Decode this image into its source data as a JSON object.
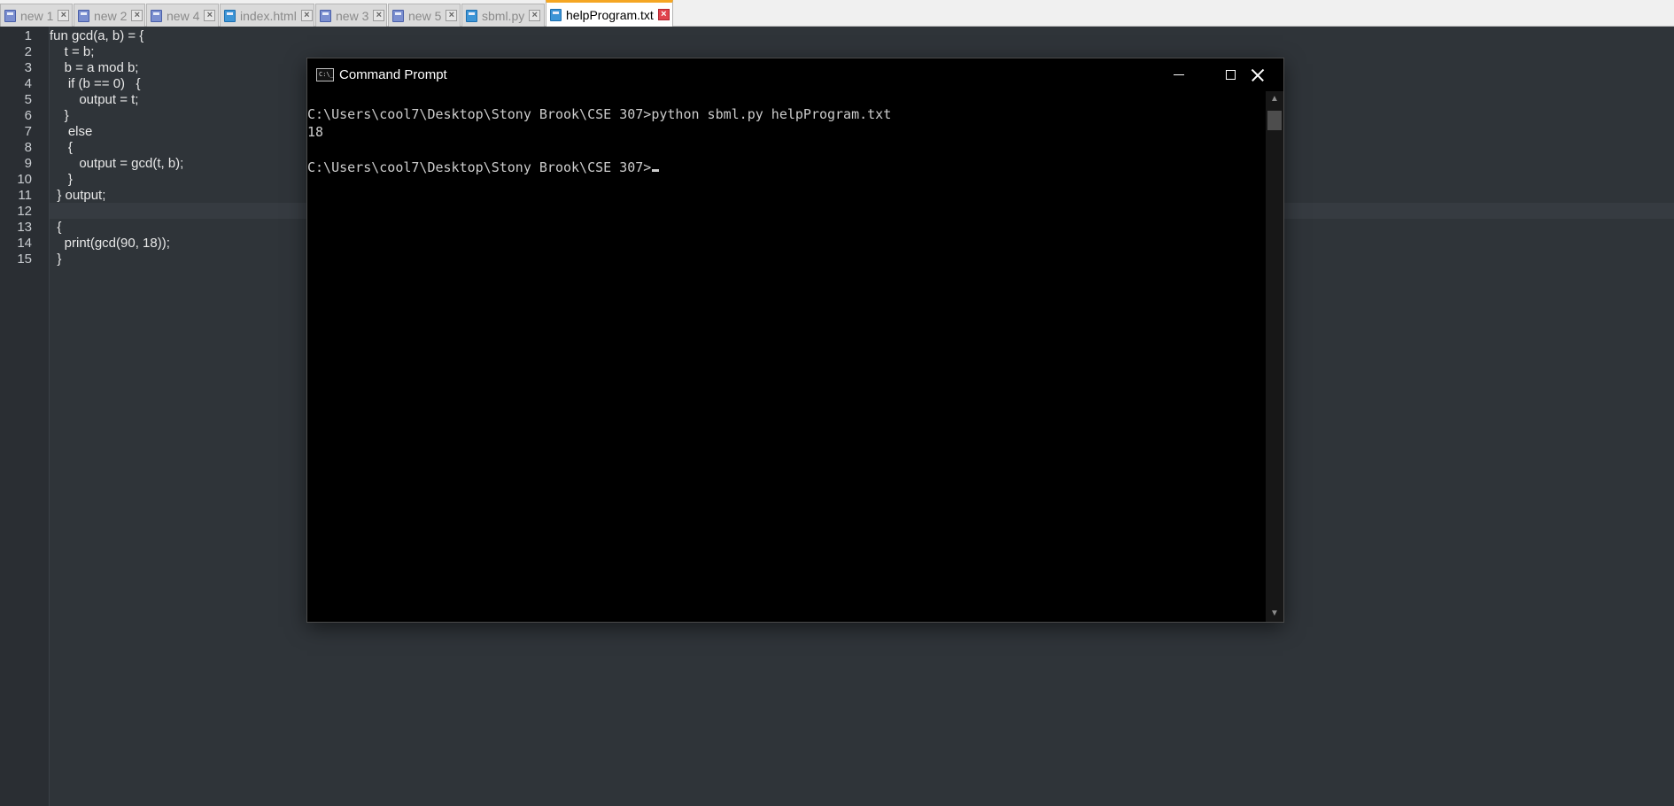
{
  "tabs": [
    {
      "label": "new 1",
      "icon": "document-icon",
      "active": false
    },
    {
      "label": "new 2",
      "icon": "document-icon",
      "active": false
    },
    {
      "label": "new 4",
      "icon": "document-icon",
      "active": false
    },
    {
      "label": "index.html",
      "icon": "document-icon",
      "active": false
    },
    {
      "label": "new 3",
      "icon": "document-icon",
      "active": false
    },
    {
      "label": "new 5",
      "icon": "document-icon",
      "active": false
    },
    {
      "label": "sbml.py",
      "icon": "document-icon",
      "active": false
    },
    {
      "label": "helpProgram.txt",
      "icon": "document-icon",
      "active": true
    }
  ],
  "editor": {
    "line_numbers": [
      "1",
      "2",
      "3",
      "4",
      "5",
      "6",
      "7",
      "8",
      "9",
      "10",
      "11",
      "12",
      "13",
      "14",
      "15"
    ],
    "lines": [
      "fun gcd(a, b) = {",
      "    t = b;",
      "    b = a mod b;",
      "     if (b == 0)   {",
      "        output = t;",
      "    }",
      "     else",
      "     {",
      "        output = gcd(t, b);",
      "     }",
      "  } output;",
      "",
      "  {",
      "    print(gcd(90, 18));",
      "  }"
    ],
    "current_line": 12
  },
  "cmd": {
    "title": "Command Prompt",
    "lines": [
      "C:\\Users\\cool7\\Desktop\\Stony Brook\\CSE 307>python sbml.py helpProgram.txt",
      "18",
      "",
      "C:\\Users\\cool7\\Desktop\\Stony Brook\\CSE 307>"
    ]
  },
  "colors": {
    "editor_bg": "#2f3439",
    "active_tab_accent": "#f5a623",
    "console_bg": "#000000",
    "console_text": "#cccccc"
  }
}
